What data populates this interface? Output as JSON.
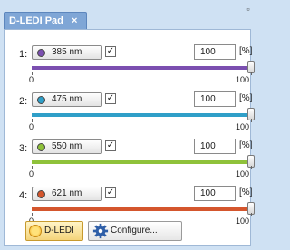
{
  "tab": {
    "title": "D-LEDI Pad",
    "close": "×"
  },
  "channels": [
    {
      "index": "1:",
      "label": "385 nm",
      "color": "#7b4fb0",
      "checked": true,
      "value": "100",
      "unit": "[%]",
      "min": "0",
      "max": "100",
      "level": 1.0
    },
    {
      "index": "2:",
      "label": "475 nm",
      "color": "#2f9fc8",
      "checked": true,
      "value": "100",
      "unit": "[%]",
      "min": "0",
      "max": "100",
      "level": 1.0
    },
    {
      "index": "3:",
      "label": "550 nm",
      "color": "#8fc23a",
      "checked": true,
      "value": "100",
      "unit": "[%]",
      "min": "0",
      "max": "100",
      "level": 1.0
    },
    {
      "index": "4:",
      "label": "621 nm",
      "color": "#d4562d",
      "checked": true,
      "value": "100",
      "unit": "[%]",
      "min": "0",
      "max": "100",
      "level": 1.0
    }
  ],
  "buttons": {
    "ledi": "D-LEDI",
    "configure": "Configure..."
  },
  "colors": {
    "accent": "#7fa6d6",
    "background": "#cfe1f3"
  }
}
